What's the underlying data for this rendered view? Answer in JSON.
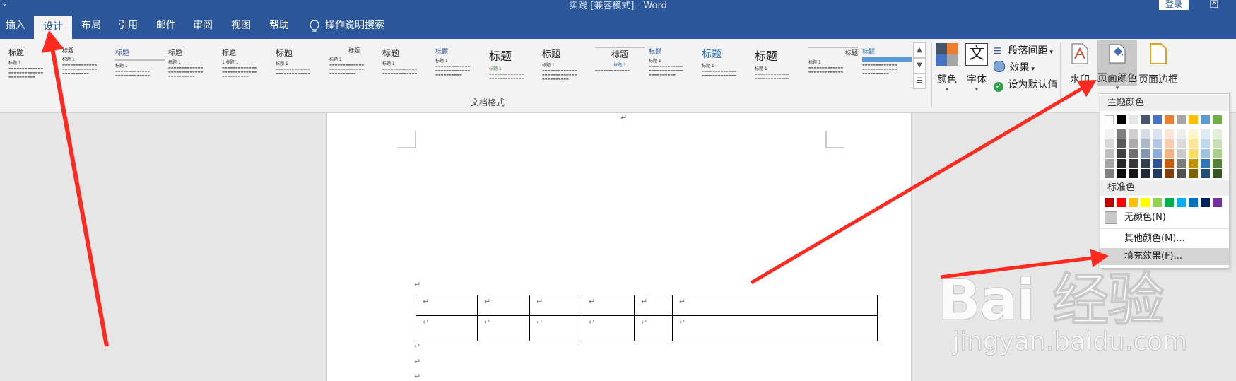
{
  "window": {
    "title": "实践 [兼容模式] - Word",
    "login_label": "登录"
  },
  "tabs": [
    {
      "label": "插入"
    },
    {
      "label": "设计"
    },
    {
      "label": "布局"
    },
    {
      "label": "引用"
    },
    {
      "label": "邮件"
    },
    {
      "label": "审阅"
    },
    {
      "label": "视图"
    },
    {
      "label": "帮助"
    }
  ],
  "tell_me": {
    "label": "操作说明搜索",
    "icon": "lightbulb-icon"
  },
  "ribbon": {
    "gallery_group_label": "文档格式",
    "style_thumbnails": [
      {
        "title": "标题",
        "subtitle": "标题 1"
      },
      {
        "title": "标题",
        "subtitle": "标题 1"
      },
      {
        "title": "标题",
        "subtitle": "标题 1"
      },
      {
        "title": "标题",
        "subtitle": "标题 1"
      },
      {
        "title": "标题",
        "subtitle": "1 标题 1"
      },
      {
        "title": "标题",
        "subtitle": "标题 1"
      },
      {
        "title": "标题",
        "subtitle": "标题 1"
      },
      {
        "title": "标题",
        "subtitle": "标题 1"
      },
      {
        "title": "标题",
        "subtitle": "标题 1"
      },
      {
        "title": "标题",
        "subtitle": "标题 1"
      },
      {
        "title": "标题",
        "subtitle": "标题 1"
      },
      {
        "title": "标题",
        "subtitle": "标题 1"
      },
      {
        "title": "标题",
        "subtitle": "标题 1"
      },
      {
        "title": "标题",
        "subtitle": "标题 1"
      },
      {
        "title": "标题",
        "subtitle": "标题 1"
      },
      {
        "title": "标题",
        "subtitle": "标题 1"
      }
    ],
    "colors_label": "颜色",
    "fonts_label": "字体",
    "fonts_glyph": "文",
    "paragraph_spacing_label": "段落间距",
    "effects_label": "效果",
    "set_default_label": "设为默认值",
    "watermark_label": "水印",
    "page_color_label": "页面颜色",
    "page_borders_label": "页面边框"
  },
  "document": {
    "paragraph_mark": "↵",
    "table_rows": 2,
    "table_cols": 6
  },
  "page_color_menu": {
    "theme_colors_header": "主题颜色",
    "standard_colors_header": "标准色",
    "no_color_label": "无颜色(N)",
    "more_colors_label": "其他颜色(M)...",
    "fill_effects_label": "填充效果(F)...",
    "theme_top_row": [
      "#FFFFFF",
      "#000000",
      "#E7E6E6",
      "#44546A",
      "#4472C4",
      "#ED7D31",
      "#A5A5A5",
      "#FFC000",
      "#5B9BD5",
      "#70AD47"
    ],
    "theme_shades": [
      [
        "#F2F2F2",
        "#7F7F7F",
        "#D0CECE",
        "#D6DCE4",
        "#D9E2F3",
        "#FBE5D5",
        "#EDEDED",
        "#FFF2CC",
        "#DEEAF6",
        "#E2EFD9"
      ],
      [
        "#D8D8D8",
        "#595959",
        "#AEABAB",
        "#ADB9CA",
        "#B4C6E7",
        "#F7CBAC",
        "#DBDBDB",
        "#FEE599",
        "#BDD7EE",
        "#C5E0B3"
      ],
      [
        "#BFBFBF",
        "#3F3F3F",
        "#757070",
        "#8496B0",
        "#8EAADB",
        "#F4B183",
        "#C9C9C9",
        "#FFD965",
        "#9CC3E5",
        "#A8D08D"
      ],
      [
        "#A5A5A5",
        "#262626",
        "#3A3838",
        "#323F4F",
        "#2F5496",
        "#C55A11",
        "#7B7B7B",
        "#BF9000",
        "#2E75B5",
        "#538135"
      ],
      [
        "#7F7F7F",
        "#0C0C0C",
        "#171616",
        "#222A35",
        "#1F3864",
        "#833C0B",
        "#525252",
        "#7F6000",
        "#1E4E79",
        "#375623"
      ]
    ],
    "standard_colors": [
      "#C00000",
      "#FF0000",
      "#FFC000",
      "#FFFF00",
      "#92D050",
      "#00B050",
      "#00B0F0",
      "#0070C0",
      "#002060",
      "#7030A0"
    ]
  },
  "watermark": {
    "logo_text": "Bai 经验",
    "url": "jingyan.baidu.com"
  },
  "colors": {
    "title_bar": "#2B579A",
    "ribbon": "#F3F3F3",
    "annotation_arrow": "#FF2A1F"
  }
}
